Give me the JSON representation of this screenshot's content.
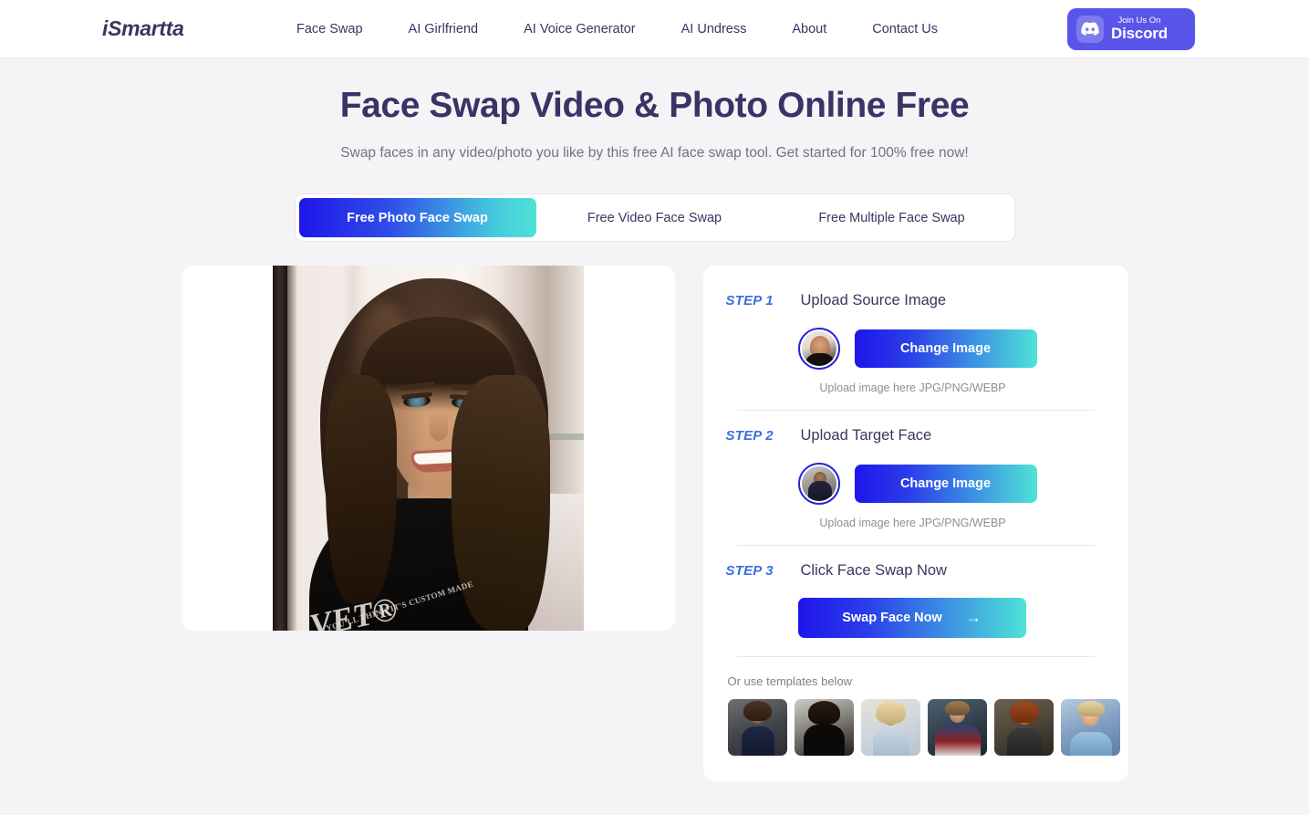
{
  "header": {
    "logo": "iSmartta",
    "nav": [
      {
        "label": "Face Swap"
      },
      {
        "label": "AI Girlfriend"
      },
      {
        "label": "AI Voice Generator"
      },
      {
        "label": "AI Undress"
      },
      {
        "label": "About"
      },
      {
        "label": "Contact Us"
      }
    ],
    "discord": {
      "top_label": "Join Us On",
      "name": "Discord",
      "icon": "discord-icon",
      "bg_color": "#5a55ea"
    }
  },
  "hero": {
    "title": "Face Swap Video & Photo Online Free",
    "subtitle": "Swap faces in any video/photo you like by this free AI face swap tool. Get started for 100% free now!",
    "title_color": "#3b3366"
  },
  "tabs": {
    "active_index": 0,
    "items": [
      {
        "label": "Free Photo Face Swap"
      },
      {
        "label": "Free Video Face Swap"
      },
      {
        "label": "Free Multiple Face Swap"
      }
    ]
  },
  "preview": {
    "alt": "Uploaded source photo preview of a smiling woman with long brown hair wearing a black t-shirt"
  },
  "steps": [
    {
      "number": "STEP 1",
      "title": "Upload Source Image",
      "button_label": "Change Image",
      "hint": "Upload image here JPG/PNG/WEBP",
      "avatar_alt": "source image thumbnail"
    },
    {
      "number": "STEP 2",
      "title": "Upload Target Face",
      "button_label": "Change Image",
      "hint": "Upload image here JPG/PNG/WEBP",
      "avatar_alt": "target face thumbnail"
    },
    {
      "number": "STEP 3",
      "title": "Click Face Swap Now",
      "button_label": "Swap Face Now",
      "button_arrow": "→"
    }
  ],
  "templates": {
    "label": "Or use templates below",
    "items": [
      {
        "alt": "template-schoolgirl"
      },
      {
        "alt": "template-dark-haired-woman"
      },
      {
        "alt": "template-blonde-woman"
      },
      {
        "alt": "template-captain-america"
      },
      {
        "alt": "template-red-haired-warrior"
      },
      {
        "alt": "template-blond-man"
      }
    ]
  },
  "colors": {
    "page_bg": "#f4f4f6",
    "accent_blue": "#1f15ea",
    "accent_cyan": "#4fe3d6",
    "step_label": "#3a6fe0",
    "avatar_ring": "#2323dd"
  }
}
